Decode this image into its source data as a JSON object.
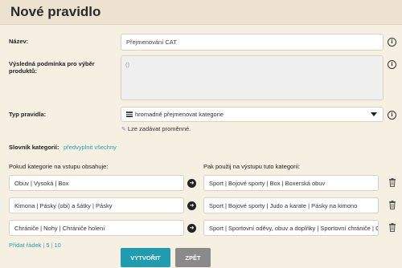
{
  "header": {
    "title": "Nové pravidlo"
  },
  "name_field": {
    "label": "Název:",
    "value": "Přejmenování CAT"
  },
  "condition_field": {
    "label": "Výsledná podmínka pro výběr produktů:",
    "value": "()"
  },
  "rule_type": {
    "label": "Typ pravidla:",
    "value": "hromadně přejmenovat kategorie"
  },
  "hint": "Lze zadávat proměnné.",
  "dictionary": {
    "label": "Slovník kategorií:",
    "prefill_link": "předvyplnit všechny"
  },
  "columns": {
    "input_header": "Pokud kategorie na vstupu obsahuje:",
    "output_header": "Pak použij na výstupu tuto kategorii:"
  },
  "rows": [
    {
      "input": "Obuv | Vysoká | Box",
      "output": "Sport | Bojové sporty | Box | Boxerská obuv"
    },
    {
      "input": "Kimona | Pásky (obi) a šátky | Pásky",
      "output": "Sport | Bojové sporty | Judo a karate | Pásky na kimono"
    },
    {
      "input": "Chrániče | Nohy | Chrániče holení",
      "output": "Sport | Sportovní oděvy, obuv a doplňky | Sportovní chrániče | C"
    }
  ],
  "footer": {
    "add_row": "Přidat řádek",
    "add_5": "5",
    "add_10": "10"
  },
  "buttons": {
    "create": "VYTVOŘIT",
    "back": "ZPĚT"
  },
  "icons": {
    "info": "info-icon",
    "arrow": "arrow-right-icon",
    "trash": "trash-icon",
    "list": "list-icon",
    "hint": "sparkle-icon"
  },
  "colors": {
    "accent": "#1f9cb0",
    "link": "#2d9bb3",
    "background": "#f6f0e3",
    "header": "#ece2cf"
  }
}
